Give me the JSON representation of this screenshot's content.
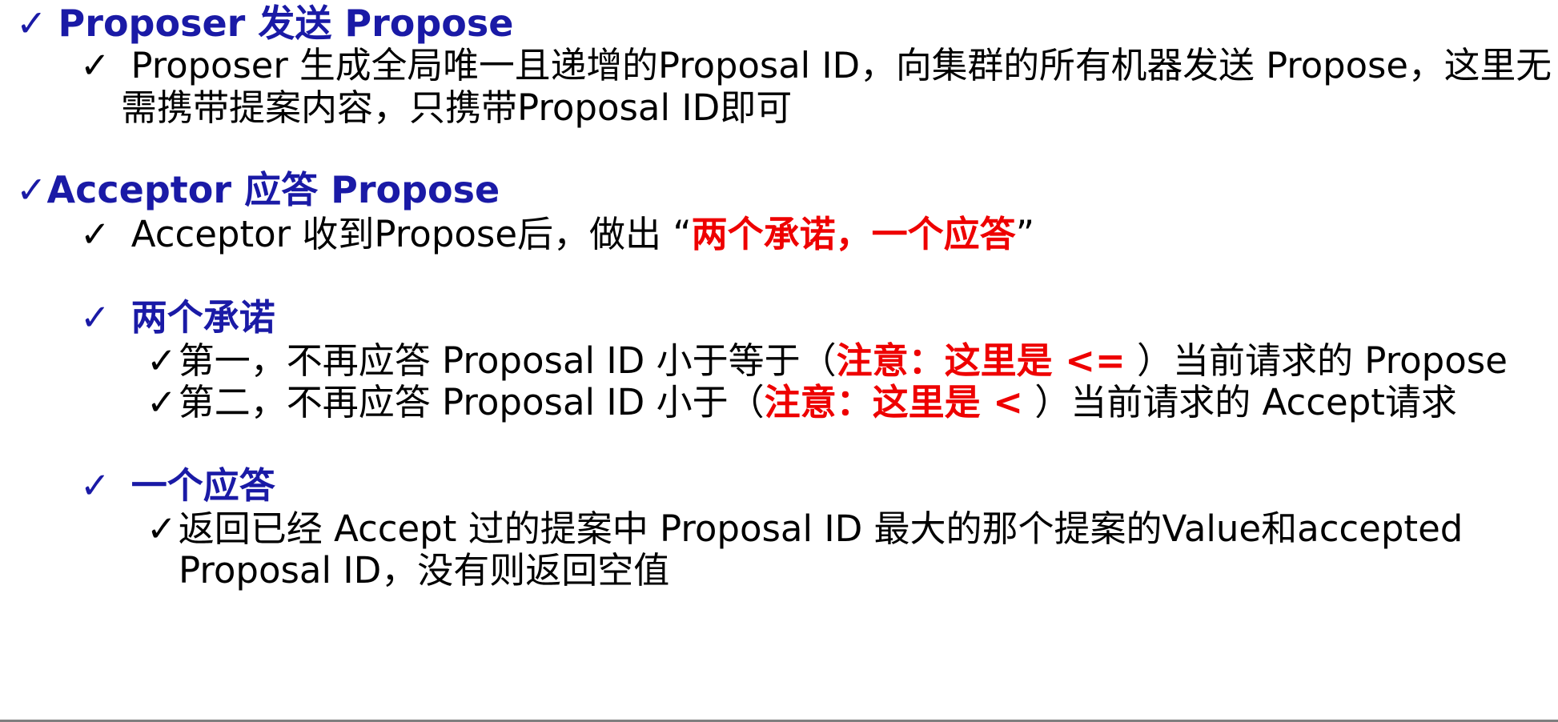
{
  "check_glyph": "✓",
  "colors": {
    "heading": "#1a1aa6",
    "body": "#000000",
    "emphasis": "#ee0000"
  },
  "section1": {
    "heading": "Proposer 发送 Propose",
    "item_line1": "Proposer 生成全局唯一且递增的Proposal ID，向集群的所有机器发送 Propose，这里无",
    "item_line2": "需携带提案内容，只携带Proposal ID即可"
  },
  "section2": {
    "heading": "Acceptor 应答 Propose",
    "item_prefix": "Acceptor 收到Propose后，做出 “",
    "item_emphasis": "两个承诺，一个应答",
    "item_suffix": "”",
    "promises": {
      "heading": "两个承诺",
      "first_prefix": "第一，不再应答 Proposal ID 小于等于（",
      "first_note": "注意：这里是 <=",
      "first_suffix": " ）当前请求的 Propose",
      "second_prefix": "第二，不再应答 Proposal ID 小于（",
      "second_note": "注意：这里是 <",
      "second_suffix": " ）当前请求的 Accept请求"
    },
    "response": {
      "heading": "一个应答",
      "line1": "返回已经 Accept 过的提案中 Proposal ID 最大的那个提案的Value和accepted",
      "line2": "Proposal ID，没有则返回空值"
    }
  }
}
